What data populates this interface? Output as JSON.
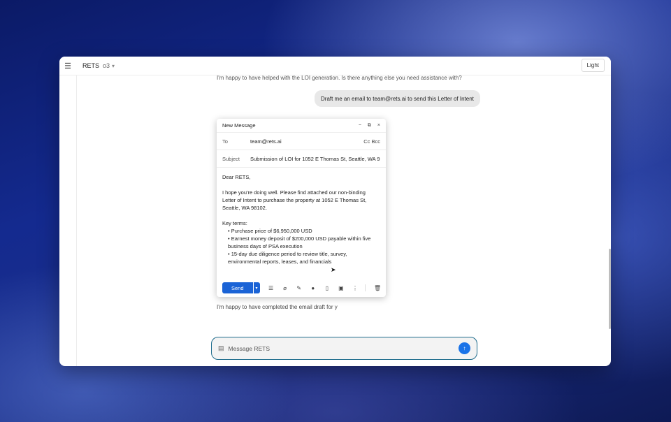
{
  "app": {
    "title": "RETS",
    "model": "o3",
    "model_caret": "▾",
    "theme_toggle": "Light",
    "menu_icon": "☰"
  },
  "chat": {
    "previous_message": "I'm happy to have helped with the LOI generation. Is there anything else you need assistance with?",
    "user_message": "Draft me an email to team@rets.ai to send this Letter of Intent",
    "status_message": "I'm happy to have completed the email draft for y"
  },
  "compose": {
    "title": "New Message",
    "minimize": "−",
    "popout": "⧉",
    "close": "×",
    "to_label": "To",
    "to_value": "team@rets.ai",
    "cc_bcc": "Cc Bcc",
    "subject_label": "Subject",
    "subject_value": "Submission of LOI for 1052 E Thomas St, Seattle, WA 9",
    "greeting": "Dear RETS,",
    "intro": "I hope you're doing well. Please find attached our non-binding Letter of Intent to purchase the property at 1052 E Thomas St, Seattle, WA 98102.",
    "key_terms_label": "Key terms:",
    "terms": [
      "• Purchase price of $6,950,000 USD",
      "• Earnest money deposit of $200,000 USD payable within five business days of PSA execution",
      "• 15-day due diligence period to review title, survey, environmental reports, leases, and financials"
    ],
    "send_label": "Send",
    "send_more": "▾",
    "toolbar_icons": [
      "format-list-icon",
      "attach-icon",
      "pen-icon",
      "circle-icon",
      "file-icon",
      "image-icon",
      "more-icon",
      "trash-icon"
    ]
  },
  "input": {
    "placeholder": "Message RETS",
    "send_icon": "↑"
  },
  "colors": {
    "accent": "#1a63d6",
    "input_border": "#1d6b8c"
  }
}
